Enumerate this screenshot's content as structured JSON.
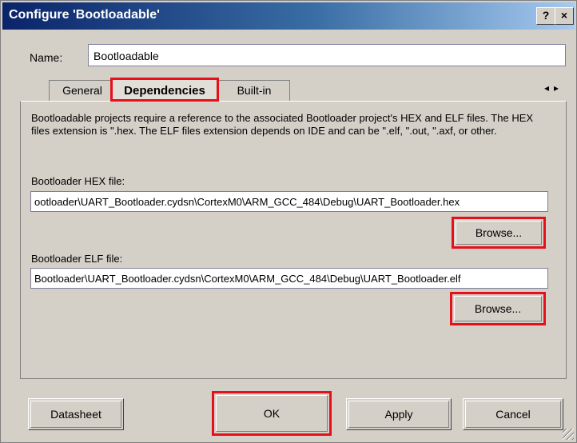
{
  "window": {
    "title": "Configure 'Bootloadable'",
    "help_label": "?",
    "close_label": "×"
  },
  "name_field": {
    "label": "Name:",
    "value": "Bootloadable"
  },
  "tabs": [
    {
      "label": "General",
      "active": false
    },
    {
      "label": "Dependencies",
      "active": true
    },
    {
      "label": "Built-in",
      "active": false
    }
  ],
  "tab_scroll": {
    "left": "◂",
    "right": "▸"
  },
  "description": "Bootloadable projects require a reference to the associated Bootloader project's HEX and ELF files. The HEX files extension is \".hex. The ELF files extension depends on IDE and can be \".elf, \".out, \".axf, or other.",
  "hex_file": {
    "label": "Bootloader HEX file:",
    "value": "ootloader\\UART_Bootloader.cydsn\\CortexM0\\ARM_GCC_484\\Debug\\UART_Bootloader.hex",
    "browse_label": "Browse..."
  },
  "elf_file": {
    "label": "Bootloader ELF file:",
    "value": "Bootloader\\UART_Bootloader.cydsn\\CortexM0\\ARM_GCC_484\\Debug\\UART_Bootloader.elf",
    "browse_label": "Browse..."
  },
  "footer": {
    "datasheet_label": "Datasheet",
    "ok_label": "OK",
    "apply_label": "Apply",
    "cancel_label": "Cancel"
  },
  "colors": {
    "highlight": "#e5101a",
    "titlebar_start": "#0a246a",
    "titlebar_end": "#a6caf0"
  }
}
